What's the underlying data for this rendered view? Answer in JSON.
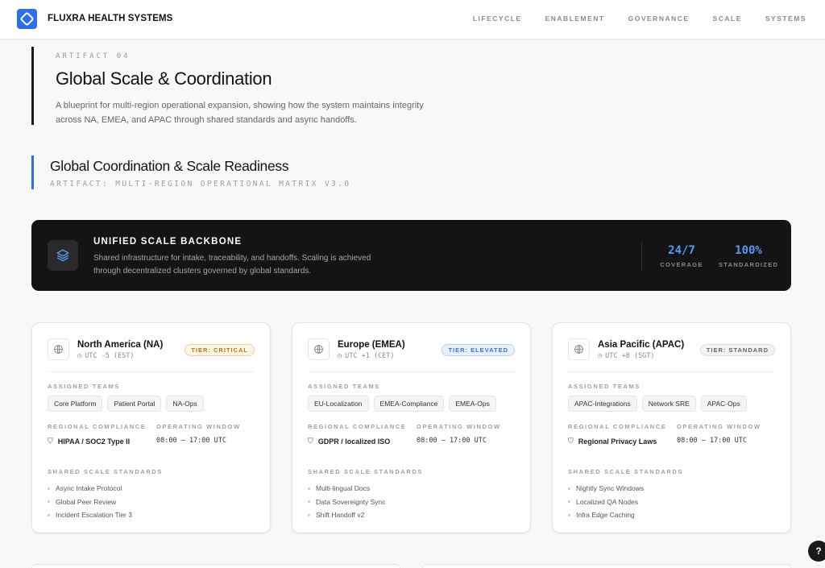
{
  "brand": "FLUXRA HEALTH SYSTEMS",
  "nav": [
    "LIFECYCLE",
    "ENABLEMENT",
    "GOVERNANCE",
    "SCALE",
    "SYSTEMS"
  ],
  "hero": {
    "eyebrow": "ARTIFACT 04",
    "title": "Global Scale & Coordination",
    "description": "A blueprint for multi-region operational expansion, showing how the system maintains integrity across NA, EMEA, and APAC through shared standards and async handoffs."
  },
  "section": {
    "title": "Global Coordination & Scale Readiness",
    "subtitle": "ARTIFACT: MULTI-REGION OPERATIONAL MATRIX V3.0"
  },
  "backbone": {
    "icon": "layers-icon",
    "title": "UNIFIED SCALE BACKBONE",
    "description": "Shared infrastructure for intake, traceability, and handoffs. Scaling is achieved through decentralized clusters governed by global standards.",
    "stats": [
      {
        "value": "24/7",
        "label": "COVERAGE"
      },
      {
        "value": "100%",
        "label": "STANDARDIZED"
      }
    ]
  },
  "labels": {
    "teams": "ASSIGNED TEAMS",
    "compliance": "REGIONAL COMPLIANCE",
    "window": "OPERATING WINDOW",
    "standards": "SHARED SCALE STANDARDS"
  },
  "regions": [
    {
      "name": "North America (NA)",
      "tz": "UTC -5 (EST)",
      "tier": "TIER: CRITICAL",
      "teams": [
        "Core Platform",
        "Patient Portal",
        "NA-Ops"
      ],
      "compliance": "HIPAA / SOC2 Type II",
      "window": "08:00 — 17:00 UTC",
      "standards": [
        "Async Intake Protocol",
        "Global Peer Review",
        "Incident Escalation Tier 3"
      ]
    },
    {
      "name": "Europe (EMEA)",
      "tz": "UTC +1 (CET)",
      "tier": "TIER: ELEVATED",
      "teams": [
        "EU-Localization",
        "EMEA-Compliance",
        "EMEA-Ops"
      ],
      "compliance": "GDPR / localized ISO",
      "window": "08:00 — 17:00 UTC",
      "standards": [
        "Multi-lingual Docs",
        "Data Sovereignty Sync",
        "Shift Handoff v2"
      ]
    },
    {
      "name": "Asia Pacific (APAC)",
      "tz": "UTC +8 (SGT)",
      "tier": "TIER: STANDARD",
      "teams": [
        "APAC-Integrations",
        "Network SRE",
        "APAC-Ops"
      ],
      "compliance": "Regional Privacy Laws",
      "window": "08:00 — 17:00 UTC",
      "standards": [
        "Nightly Sync Windows",
        "Localized QA Nodes",
        "Infra Edge Caching"
      ]
    }
  ],
  "help": "?",
  "colors": {
    "accent": "#2f6df0",
    "dark": "#141414",
    "critical": "#b3761a",
    "elevated": "#3a6fd6"
  }
}
